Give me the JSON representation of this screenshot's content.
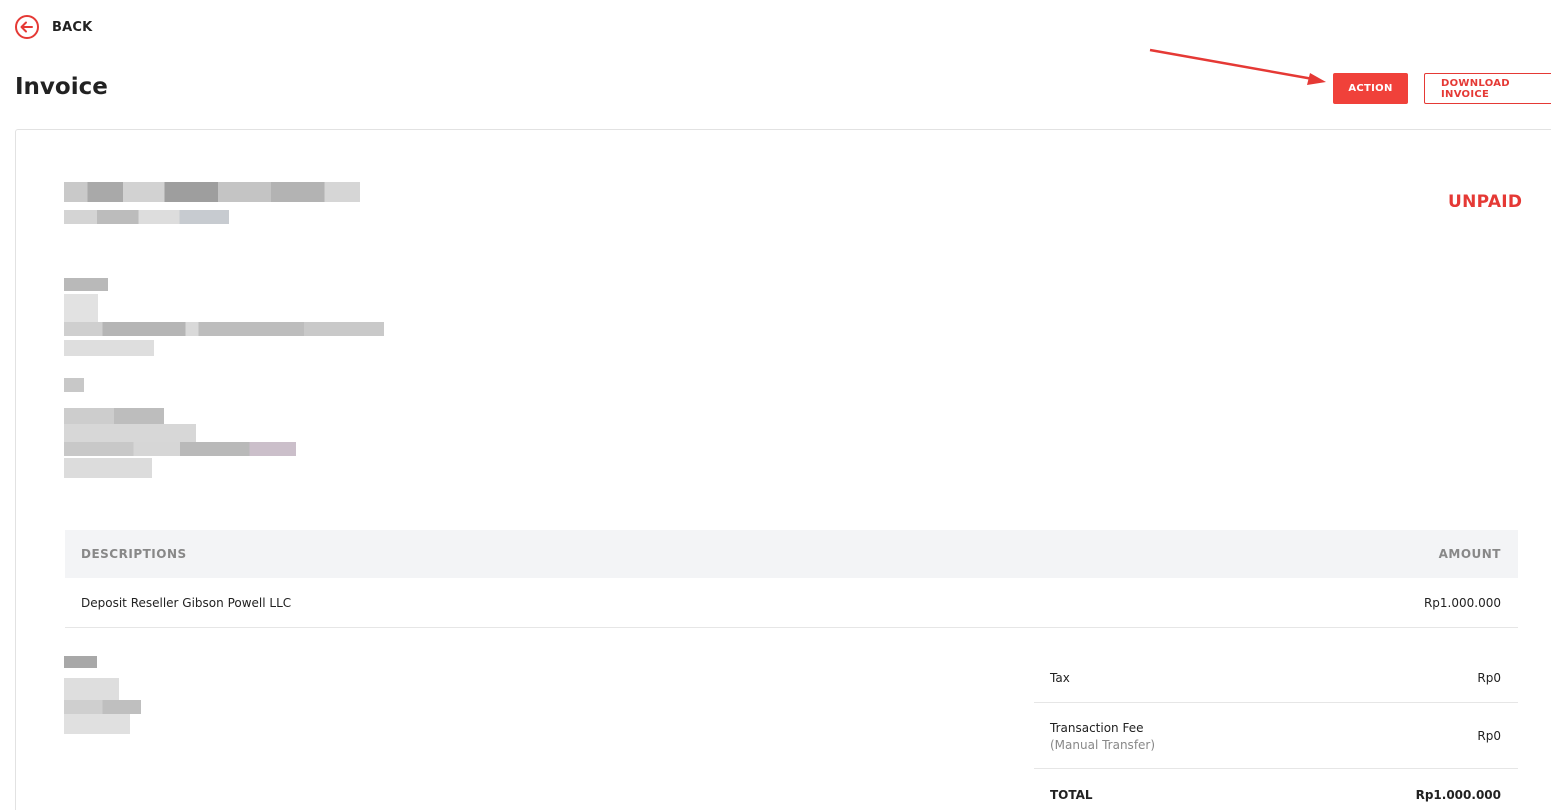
{
  "nav": {
    "back_label": "BACK"
  },
  "header": {
    "title": "Invoice",
    "action_label": "ACTION",
    "download_label": "DOWNLOAD INVOICE"
  },
  "invoice": {
    "status": "UNPAID",
    "table": {
      "columns": [
        "DESCRIPTIONS",
        "AMOUNT"
      ],
      "rows": [
        {
          "description": "Deposit Reseller Gibson Powell LLC",
          "amount": "Rp1.000.000"
        }
      ]
    },
    "summary": {
      "tax_label": "Tax",
      "tax_value": "Rp0",
      "fee_label": "Transaction Fee",
      "fee_sublabel": "(Manual Transfer)",
      "fee_value": "Rp0",
      "total_label": "TOTAL",
      "total_value": "Rp1.000.000"
    }
  },
  "colors": {
    "accent": "#f0413a",
    "status_unpaid": "#e53935",
    "annotation_arrow": "#e53935"
  },
  "icons": {
    "back": "circle-arrow-left-icon"
  }
}
